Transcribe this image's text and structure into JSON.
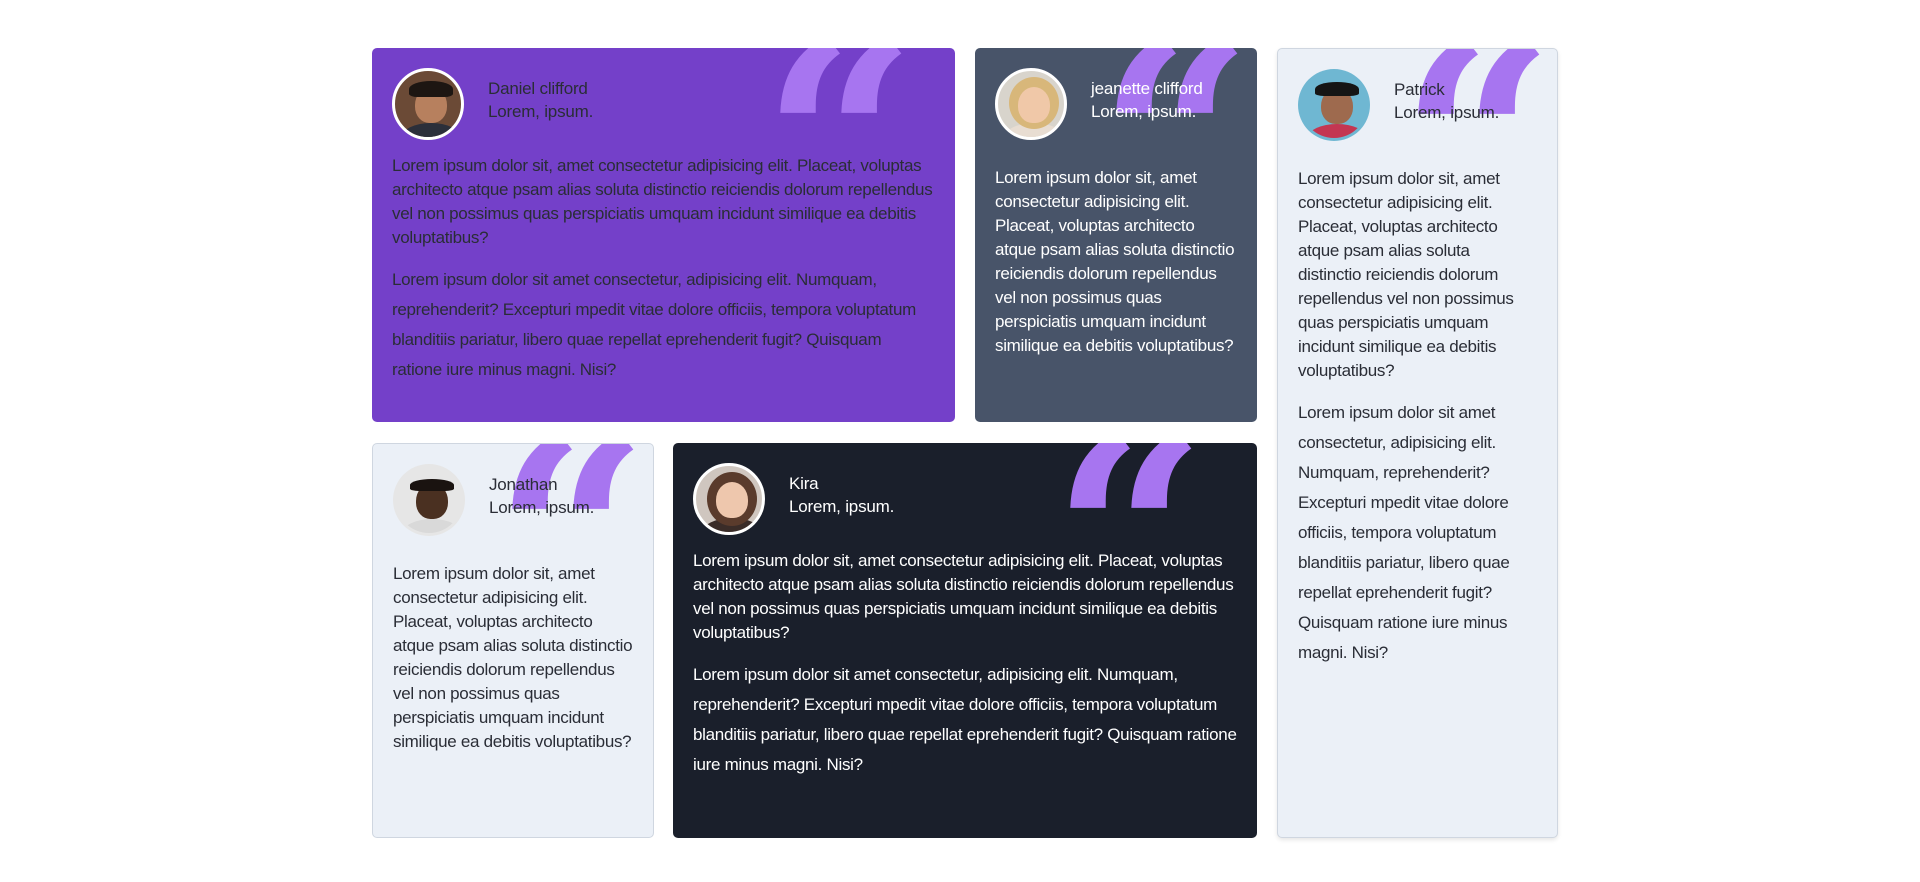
{
  "colors": {
    "purple_card": "#7440c9",
    "slate_card": "#485469",
    "light_card": "#ebf0f7",
    "dark_card": "#1a1f2b",
    "quote_mark": "#a775f0",
    "text_dark": "#2a2d36",
    "text_light": "#ffffff"
  },
  "testimonials": [
    {
      "name": "Daniel clifford",
      "role": "Lorem, ipsum.",
      "quote_icon": "quote-icon",
      "p1": "Lorem ipsum dolor sit, amet consectetur adipisicing elit. Placeat, voluptas architecto atque psam alias soluta distinctio reiciendis dolorum repellendus vel non possimus quas perspiciatis umquam incidunt similique ea debitis voluptatibus?",
      "p2": "Lorem ipsum dolor sit amet consectetur, adipisicing elit. Numquam, reprehenderit? Excepturi mpedit vitae dolore officiis, tempora voluptatum blanditiis pariatur, libero quae repellat eprehenderit fugit? Quisquam ratione iure minus magni. Nisi?"
    },
    {
      "name": "jeanette clifford",
      "role": "Lorem, ipsum.",
      "quote_icon": "quote-icon",
      "p1": "Lorem ipsum dolor sit, amet consectetur adipisicing elit. Placeat, voluptas architecto atque psam alias soluta distinctio reiciendis dolorum repellendus vel non possimus quas perspiciatis umquam incidunt similique ea debitis voluptatibus?"
    },
    {
      "name": "Patrick",
      "role": "Lorem, ipsum.",
      "quote_icon": "quote-icon",
      "p1": "Lorem ipsum dolor sit, amet consectetur adipisicing elit. Placeat, voluptas architecto atque psam alias soluta distinctio reiciendis dolorum repellendus vel non possimus quas perspiciatis umquam incidunt similique ea debitis voluptatibus?",
      "p2": "Lorem ipsum dolor sit amet consectetur, adipisicing elit. Numquam, reprehenderit? Excepturi mpedit vitae dolore officiis, tempora voluptatum blanditiis pariatur, libero quae repellat eprehenderit fugit? Quisquam ratione iure minus magni. Nisi?"
    },
    {
      "name": "Jonathan",
      "role": "Lorem, ipsum.",
      "quote_icon": "quote-icon",
      "p1": "Lorem ipsum dolor sit, amet consectetur adipisicing elit. Placeat, voluptas architecto atque psam alias soluta distinctio reiciendis dolorum repellendus vel non possimus quas perspiciatis umquam incidunt similique ea debitis voluptatibus?"
    },
    {
      "name": "Kira",
      "role": "Lorem, ipsum.",
      "quote_icon": "quote-icon",
      "p1": "Lorem ipsum dolor sit, amet consectetur adipisicing elit. Placeat, voluptas architecto atque psam alias soluta distinctio reiciendis dolorum repellendus vel non possimus quas perspiciatis umquam incidunt similique ea debitis voluptatibus?",
      "p2": "Lorem ipsum dolor sit amet consectetur, adipisicing elit. Numquam, reprehenderit? Excepturi mpedit vitae dolore officiis, tempora voluptatum blanditiis pariatur, libero quae repellat eprehenderit fugit? Quisquam ratione iure minus magni. Nisi?"
    }
  ]
}
